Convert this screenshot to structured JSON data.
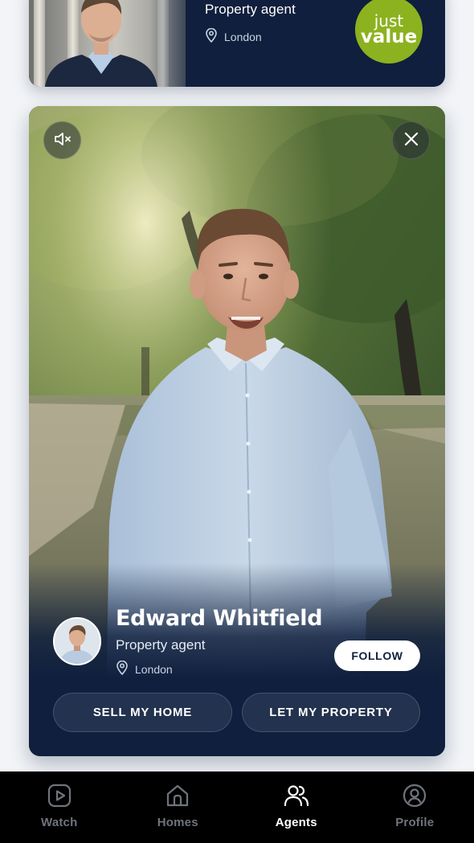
{
  "previous_card": {
    "title": "Property agent",
    "location": "London",
    "brand_badge": {
      "line1": "just",
      "line2": "value",
      "color": "#8cb21f"
    }
  },
  "video_card": {
    "mute_icon": "volume-mute-icon",
    "close_icon": "close-icon",
    "agent": {
      "name": "Edward Whitfield",
      "title": "Property agent",
      "location": "London"
    },
    "follow_label": "FOLLOW",
    "actions": {
      "sell_label": "SELL MY HOME",
      "let_label": "LET MY PROPERTY"
    }
  },
  "bottom_nav": {
    "items": [
      {
        "label": "Watch",
        "icon": "play-square-icon",
        "active": false
      },
      {
        "label": "Homes",
        "icon": "home-icon",
        "active": false
      },
      {
        "label": "Agents",
        "icon": "users-icon",
        "active": true
      },
      {
        "label": "Profile",
        "icon": "user-circle-icon",
        "active": false
      }
    ]
  },
  "colors": {
    "card_navy": "#0f1f3d",
    "nav_background": "#000000",
    "nav_inactive": "#6f747c",
    "nav_active": "#ffffff"
  }
}
